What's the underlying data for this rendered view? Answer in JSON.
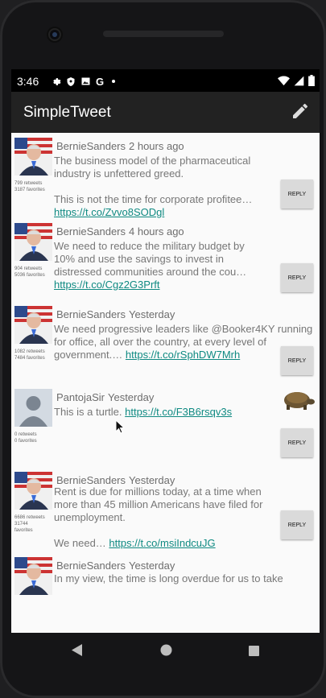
{
  "status_bar": {
    "time": "3:46",
    "left_icons": [
      "gear-icon",
      "shield-icon",
      "photo-icon",
      "google-icon",
      "dot-icon"
    ],
    "right_icons": [
      "wifi-icon",
      "signal-icon",
      "battery-icon"
    ]
  },
  "app_bar": {
    "title": "SimpleTweet",
    "compose_icon": "pencil-icon"
  },
  "reply_label": "REPLY",
  "tweets": [
    {
      "user": "BernieSanders",
      "time": "2 hours ago",
      "text": "The business model of the pharmaceutical industry is unfettered greed.\n\nThis is not the time for corporate profitee…",
      "link": "https://t.co/Zvvo8SODgl",
      "retweets": "799 retweets",
      "favorites": "3187 favorites"
    },
    {
      "user": "BernieSanders",
      "time": "4 hours ago",
      "text": "We need to reduce the military budget by 10% and use the savings to invest in distressed communities around the cou…",
      "link": "https://t.co/Cgz2G3Prft",
      "retweets": "904 retweets",
      "favorites": "5036 favorites"
    },
    {
      "user": "BernieSanders",
      "time": "Yesterday",
      "text": "We need progressive leaders like @Booker4KY running for office, all over the country, at every level of government.…",
      "link": "https://t.co/rSphDW7Mrh",
      "retweets": "1082 retweets",
      "favorites": "7484 favorites"
    },
    {
      "user": "PantojaSir",
      "time": "Yesterday",
      "text": "This is a turtle.",
      "link": "https://t.co/F3B6rsqv3s",
      "retweets": "0 retweets",
      "favorites": "0 favorites"
    },
    {
      "user": "BernieSanders",
      "time": "Yesterday",
      "text": "Rent is due for millions today, at a time when more than 45 million Americans have filed for unemployment.\n\nWe need…",
      "link": "https://t.co/msiIndcuJG",
      "retweets": "6686 retweets",
      "favorites": "31744 favorites"
    },
    {
      "user": "BernieSanders",
      "time": "Yesterday",
      "text": "In my view, the time is long overdue for us to take",
      "link": "",
      "retweets": "",
      "favorites": ""
    }
  ],
  "nav_bar": {
    "icons": [
      "back-icon",
      "home-icon",
      "recents-icon"
    ]
  }
}
